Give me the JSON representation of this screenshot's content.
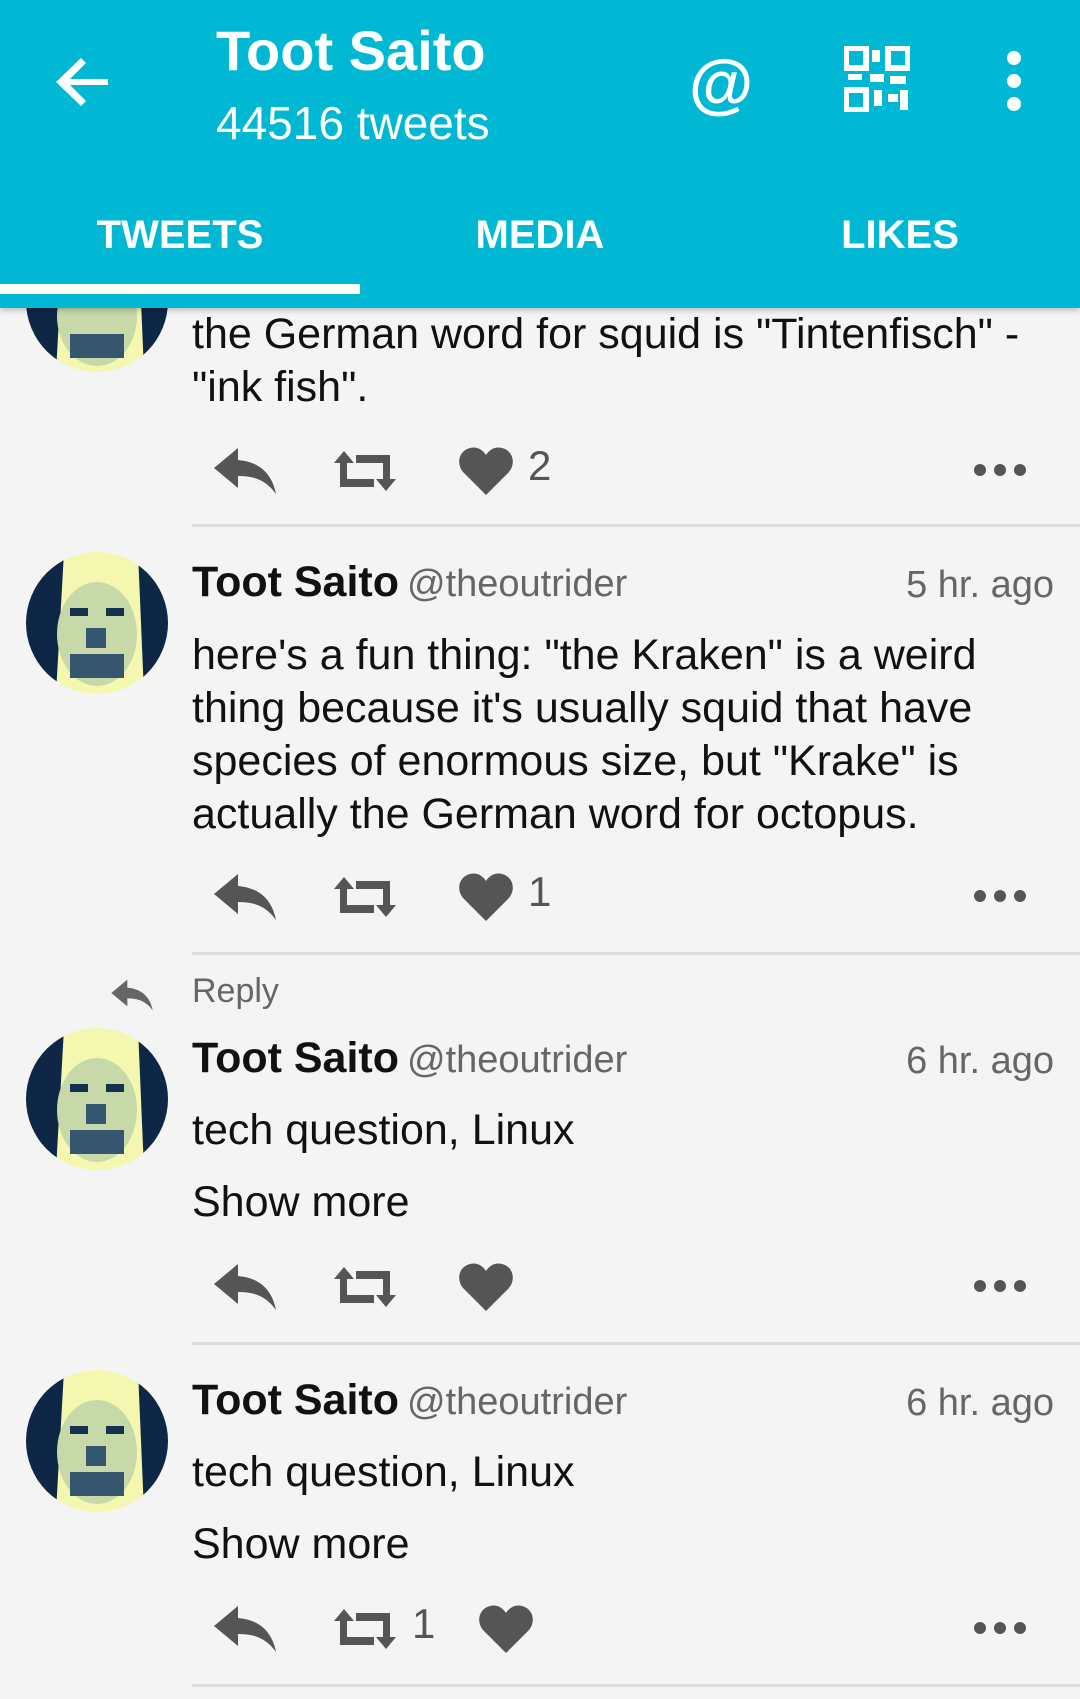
{
  "header": {
    "title": "Toot Saito",
    "subtitle": "44516 tweets",
    "at_symbol": "@"
  },
  "tabs": [
    {
      "label": "TWEETS",
      "active": true
    },
    {
      "label": "MEDIA",
      "active": false
    },
    {
      "label": "LIKES",
      "active": false
    }
  ],
  "posts": [
    {
      "text": "the German word for squid is \"Tintenfisch\" - \"ink fish\".",
      "likes": "2"
    },
    {
      "name": "Toot Saito",
      "handle": "@theoutrider",
      "time": "5 hr. ago",
      "text": "here's a fun thing: \"the Kraken\" is a weird thing because it's usually squid that have species of enormous size, but \"Krake\" is actually the German word for octopus.",
      "likes": "1"
    },
    {
      "reply_label": "Reply",
      "name": "Toot Saito",
      "handle": "@theoutrider",
      "time": "6 hr. ago",
      "text": "tech question, Linux",
      "show_more": "Show more"
    },
    {
      "name": "Toot Saito",
      "handle": "@theoutrider",
      "time": "6 hr. ago",
      "text": "tech question, Linux",
      "show_more": "Show more",
      "retweets": "1"
    }
  ],
  "colors": {
    "header_bg": "#00b8d4",
    "icon_gray": "#555555",
    "background": "#f4f4f4"
  }
}
